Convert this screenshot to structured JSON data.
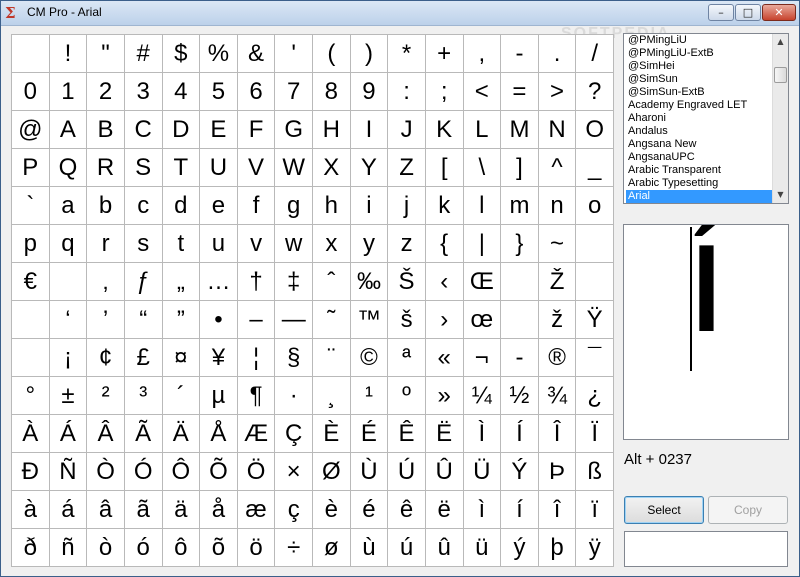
{
  "window": {
    "title": "CM Pro - Arial",
    "app_icon": "Σ",
    "buttons": {
      "minimize": "–",
      "maximize": "□",
      "close": "✕"
    }
  },
  "watermark": "SOFTPEDIA",
  "char_grid": {
    "rows": [
      [
        " ",
        "!",
        "\"",
        "#",
        "$",
        "%",
        "&",
        "'",
        "(",
        ")",
        "*",
        "+",
        ",",
        "-",
        ".",
        "/"
      ],
      [
        "0",
        "1",
        "2",
        "3",
        "4",
        "5",
        "6",
        "7",
        "8",
        "9",
        ":",
        ";",
        "<",
        "=",
        ">",
        "?"
      ],
      [
        "@",
        "A",
        "B",
        "C",
        "D",
        "E",
        "F",
        "G",
        "H",
        "I",
        "J",
        "K",
        "L",
        "M",
        "N",
        "O"
      ],
      [
        "P",
        "Q",
        "R",
        "S",
        "T",
        "U",
        "V",
        "W",
        "X",
        "Y",
        "Z",
        "[",
        "\\",
        "]",
        "^",
        "_"
      ],
      [
        "`",
        "a",
        "b",
        "c",
        "d",
        "e",
        "f",
        "g",
        "h",
        "i",
        "j",
        "k",
        "l",
        "m",
        "n",
        "o"
      ],
      [
        "p",
        "q",
        "r",
        "s",
        "t",
        "u",
        "v",
        "w",
        "x",
        "y",
        "z",
        "{",
        "|",
        "}",
        "~",
        ""
      ],
      [
        "€",
        "",
        "‚",
        "ƒ",
        "„",
        "…",
        "†",
        "‡",
        "ˆ",
        "‰",
        "Š",
        "‹",
        "Œ",
        "",
        "Ž",
        ""
      ],
      [
        "",
        "‘",
        "’",
        "“",
        "”",
        "•",
        "–",
        "—",
        "˜",
        "™",
        "š",
        "›",
        "œ",
        "",
        "ž",
        "Ÿ"
      ],
      [
        "",
        "¡",
        "¢",
        "£",
        "¤",
        "¥",
        "¦",
        "§",
        "¨",
        "©",
        "ª",
        "«",
        "¬",
        "-",
        "®",
        "¯"
      ],
      [
        "°",
        "±",
        "²",
        "³",
        "´",
        "µ",
        "¶",
        "·",
        "¸",
        "¹",
        "º",
        "»",
        "¼",
        "½",
        "¾",
        "¿"
      ],
      [
        "À",
        "Á",
        "Â",
        "Ã",
        "Ä",
        "Å",
        "Æ",
        "Ç",
        "È",
        "É",
        "Ê",
        "Ë",
        "Ì",
        "Í",
        "Î",
        "Ï"
      ],
      [
        "Ð",
        "Ñ",
        "Ò",
        "Ó",
        "Ô",
        "Õ",
        "Ö",
        "×",
        "Ø",
        "Ù",
        "Ú",
        "Û",
        "Ü",
        "Ý",
        "Þ",
        "ß"
      ],
      [
        "à",
        "á",
        "â",
        "ã",
        "ä",
        "å",
        "æ",
        "ç",
        "è",
        "é",
        "ê",
        "ë",
        "ì",
        "í",
        "î",
        "ï"
      ],
      [
        "ð",
        "ñ",
        "ò",
        "ó",
        "ô",
        "õ",
        "ö",
        "÷",
        "ø",
        "ù",
        "ú",
        "û",
        "ü",
        "ý",
        "þ",
        "ÿ"
      ]
    ]
  },
  "font_list": {
    "items": [
      "@PMingLiU",
      "@PMingLiU-ExtB",
      "@SimHei",
      "@SimSun",
      "@SimSun-ExtB",
      "Academy Engraved LET",
      "Aharoni",
      "Andalus",
      "Angsana New",
      "AngsanaUPC",
      "Arabic Transparent",
      "Arabic Typesetting",
      "Arial"
    ],
    "selected": "Arial"
  },
  "preview": {
    "glyph": "í"
  },
  "alt_code": "Alt + 0237",
  "actions": {
    "select_label": "Select",
    "copy_label": "Copy"
  },
  "output_value": ""
}
